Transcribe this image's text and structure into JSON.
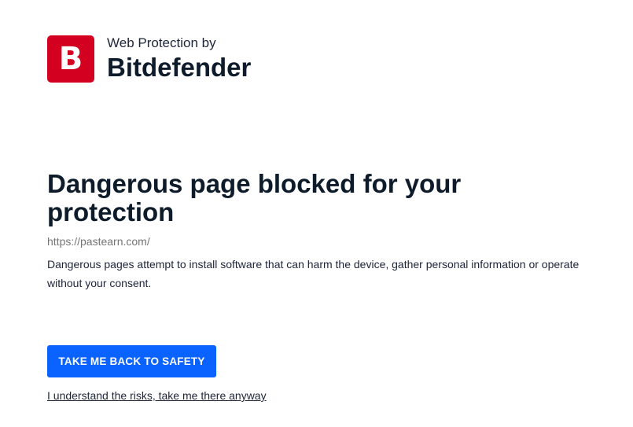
{
  "brand": {
    "logo_letter": "B",
    "subtitle": "Web Protection by",
    "name": "Bitdefender",
    "logo_color": "#d4001f"
  },
  "warning": {
    "headline": "Dangerous page blocked for your protection",
    "blocked_url": "https://pastearn.com/",
    "description": "Dangerous pages attempt to install software that can harm the device, gather personal information or operate without your consent."
  },
  "actions": {
    "safety_button_label": "TAKE ME BACK TO SAFETY",
    "safety_button_color": "#0a62ff",
    "proceed_link_label": "I understand the risks, take me there anyway"
  }
}
